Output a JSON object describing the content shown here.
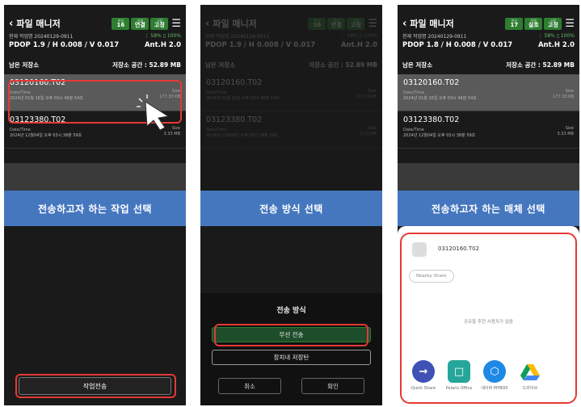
{
  "colors": {
    "accent_green": "#2e7d32",
    "caption_blue": "#4577bf",
    "highlight_red": "#e53935"
  },
  "header": {
    "back_icon": "chevron-left-icon",
    "title": "파일 매니저",
    "menu_icon": "menu-icon"
  },
  "badges": {
    "sats": {
      "label": "위성",
      "value_p1": "16",
      "value_p3": "17"
    },
    "fix": {
      "label": "연결",
      "value_p1": "연결",
      "value_p3": "실호"
    },
    "mode": {
      "label": "고정",
      "value": "고정"
    }
  },
  "job": {
    "label": "현재 작업명 20240129-0911",
    "signal": "⋮ 58% ▯ 100%"
  },
  "precision": {
    "left": "PDOP 1.9 / H 0.008 / V 0.017",
    "left_p3": "PDOP 1.8 / H 0.008 / V 0.017",
    "right": "Ant.H 2.0"
  },
  "storage": {
    "left": "남은 저장소",
    "right": "저장소 공간 : 52.89 MB"
  },
  "files": [
    {
      "name": "03120160.T02",
      "date_label": "Date/Time",
      "date": "2024년 01월 16일 오후 03시 46분 54초",
      "size_label": "Size",
      "size": "177.33 KB"
    },
    {
      "name": "03123380.T02",
      "date_label": "Date/Time",
      "date": "2024년 12월04일 오후 03시 38분 59초",
      "size_label": "Size",
      "size": "3.33 MB"
    }
  ],
  "captions": {
    "step1": "전송하고자 하는 작업 선택",
    "step2": "전송 방식 선택",
    "step3": "전송하고자 하는 매체 선택"
  },
  "bottom_button": "작업전송",
  "transfer_sheet": {
    "title": "전송 방식",
    "options": [
      "무선 전송",
      "장치내 저장탄"
    ],
    "cancel": "취소",
    "confirm": "확인"
  },
  "share_sheet": {
    "file_name": "03120160.T02",
    "chip": "Nearby Share",
    "empty_text": "공유할 추천 사용자가 없음",
    "apps": [
      {
        "name": "Quick Share",
        "icon": "quick-share-icon",
        "color": "#3f51b5"
      },
      {
        "name": "Polaris Office",
        "icon": "polaris-office-icon",
        "color": "#26a69a"
      },
      {
        "name": "네이버 MYBOX",
        "icon": "mybox-icon",
        "color": "#1e88e5"
      },
      {
        "name": "드라이브",
        "icon": "google-drive-icon",
        "color": "#ffffff"
      }
    ]
  }
}
